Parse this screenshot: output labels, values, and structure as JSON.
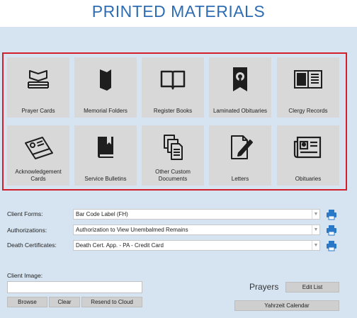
{
  "page": {
    "title": "PRINTED MATERIALS"
  },
  "tiles": [
    {
      "label": "Prayer Cards",
      "icon": "stacked-cards-icon"
    },
    {
      "label": "Memorial Folders",
      "icon": "folder-icon"
    },
    {
      "label": "Register Books",
      "icon": "open-book-icon"
    },
    {
      "label": "Laminated Obituaries",
      "icon": "laminated-portrait-icon"
    },
    {
      "label": "Clergy Records",
      "icon": "record-book-icon"
    },
    {
      "label": "Acknowledgement Cards",
      "icon": "card-envelope-icon"
    },
    {
      "label": "Service Bulletins",
      "icon": "bulletin-book-icon"
    },
    {
      "label": "Other Custom Documents",
      "icon": "documents-icon"
    },
    {
      "label": "Letters",
      "icon": "letter-pen-icon"
    },
    {
      "label": "Obituaries",
      "icon": "newspaper-icon"
    }
  ],
  "forms": {
    "client_forms_label": "Client Forms:",
    "client_forms_value": "Bar Code Label (FH)",
    "authorizations_label": "Authorizations:",
    "authorizations_value": "Authorization to View Unembalmed Remains",
    "death_certs_label": "Death Certificates:",
    "death_certs_value": "Death Cert. App. - PA - Credit Card"
  },
  "client_image": {
    "label": "Client Image:",
    "value": "",
    "browse_label": "Browse",
    "clear_label": "Clear",
    "resend_label": "Resend to Cloud"
  },
  "prayers": {
    "label": "Prayers",
    "edit_list_label": "Edit List",
    "yahrzeit_label": "Yahrzeit Calendar"
  },
  "colors": {
    "title": "#2e6db3",
    "frame": "#d21f2b",
    "printer": "#2a78c8",
    "background": "#d6e4f1"
  }
}
